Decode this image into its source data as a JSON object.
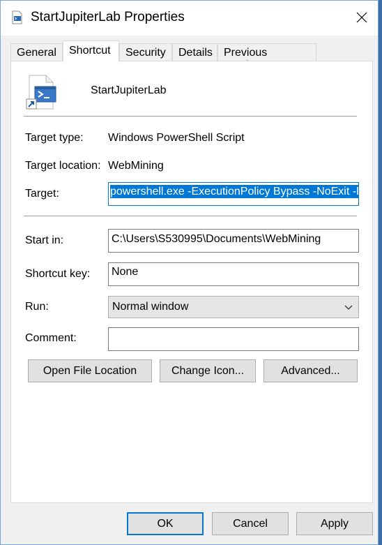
{
  "window": {
    "title": "StartJupiterLab Properties"
  },
  "tabs": [
    {
      "label": "General"
    },
    {
      "label": "Shortcut"
    },
    {
      "label": "Security"
    },
    {
      "label": "Details"
    },
    {
      "label": "Previous Versions"
    }
  ],
  "shortcut": {
    "name": "StartJupiterLab",
    "target_type_label": "Target type:",
    "target_type_value": "Windows PowerShell Script",
    "target_location_label": "Target location:",
    "target_location_value": "WebMining",
    "target_label": "Target:",
    "target_value": "powershell.exe -ExecutionPolicy Bypass -NoExit -F",
    "start_in_label": "Start in:",
    "start_in_value": "C:\\Users\\S530995\\Documents\\WebMining",
    "shortcut_key_label": "Shortcut key:",
    "shortcut_key_value": "None",
    "run_label": "Run:",
    "run_value": "Normal window",
    "comment_label": "Comment:",
    "comment_value": ""
  },
  "actions": {
    "open_file_location": "Open File Location",
    "change_icon": "Change Icon...",
    "advanced": "Advanced..."
  },
  "footer": {
    "ok": "OK",
    "cancel": "Cancel",
    "apply": "Apply"
  },
  "colors": {
    "accent": "#0078d7",
    "panel": "#ffffff",
    "dialog": "#f0f0f0"
  }
}
